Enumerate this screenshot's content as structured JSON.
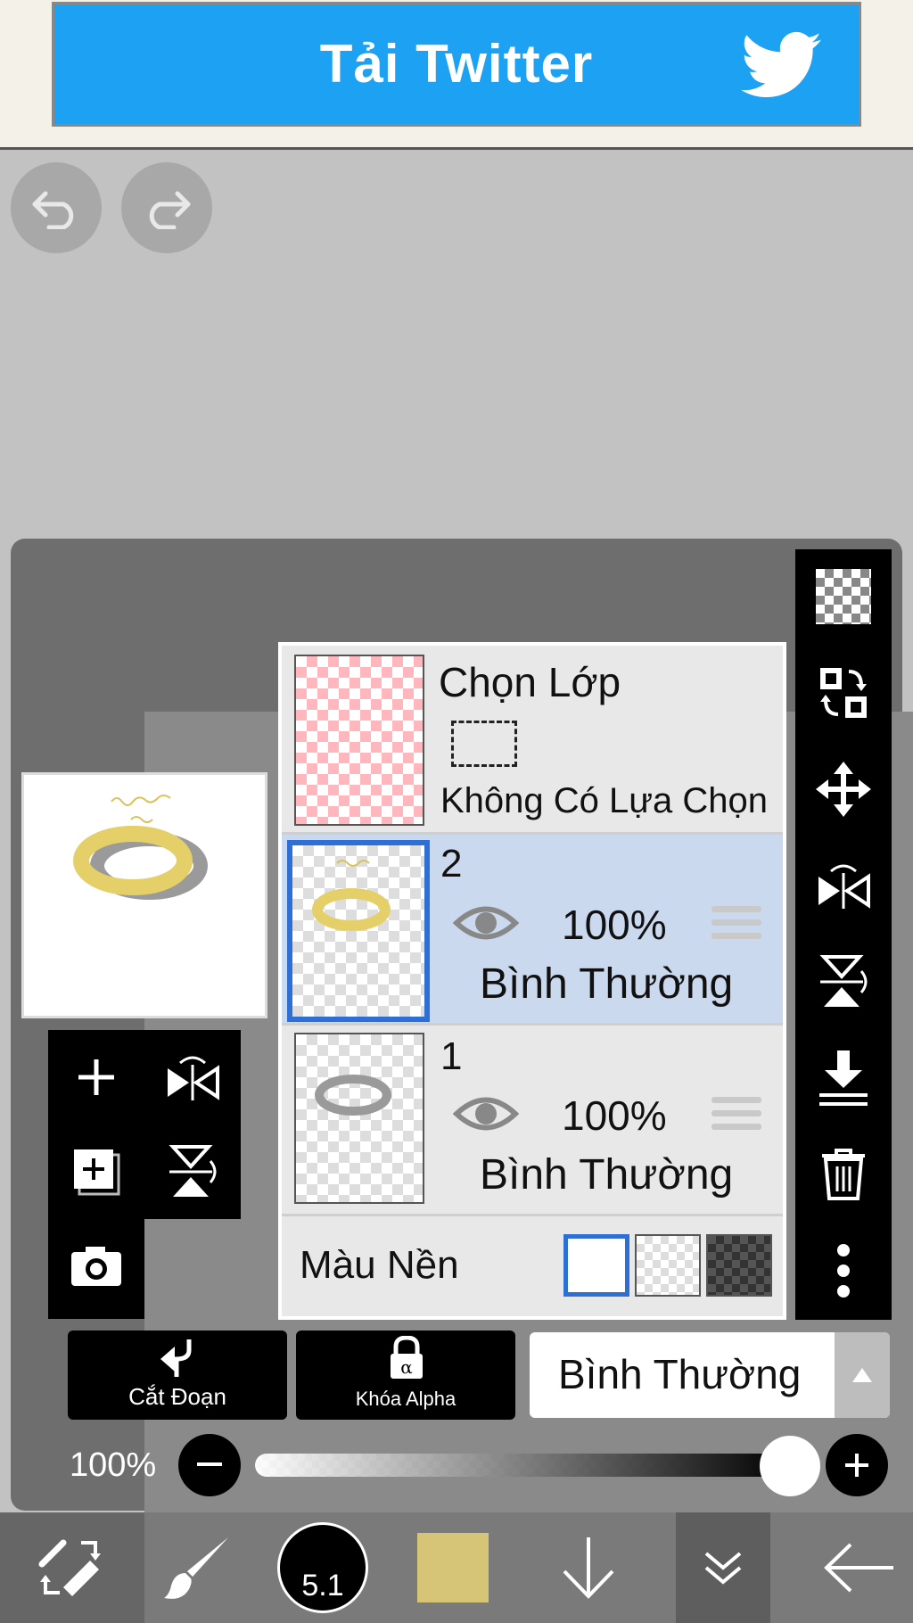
{
  "ad": {
    "text": "Tải Twitter",
    "icon": "twitter-bird-icon",
    "color": "#1da1f2"
  },
  "history": {
    "undo_icon": "undo-icon",
    "redo_icon": "redo-icon"
  },
  "selection_layer": {
    "title": "Chọn Lớp",
    "status": "Không Có Lựa Chọn"
  },
  "layers": [
    {
      "number": "2",
      "opacity": "100%",
      "blend": "Bình Thường",
      "selected": true
    },
    {
      "number": "1",
      "opacity": "100%",
      "blend": "Bình Thường",
      "selected": false
    }
  ],
  "background": {
    "label": "Màu Nền",
    "options": [
      "white",
      "transparent",
      "dark"
    ],
    "selected": "white"
  },
  "actions": {
    "clip_label": "Cắt Đoạn",
    "alpha_lock_label": "Khóa Alpha"
  },
  "blend_mode": {
    "value": "Bình Thường"
  },
  "opacity": {
    "value": "100%",
    "fraction": 1.0
  },
  "brush": {
    "size": "5.1"
  },
  "current_color": "#d6c577"
}
